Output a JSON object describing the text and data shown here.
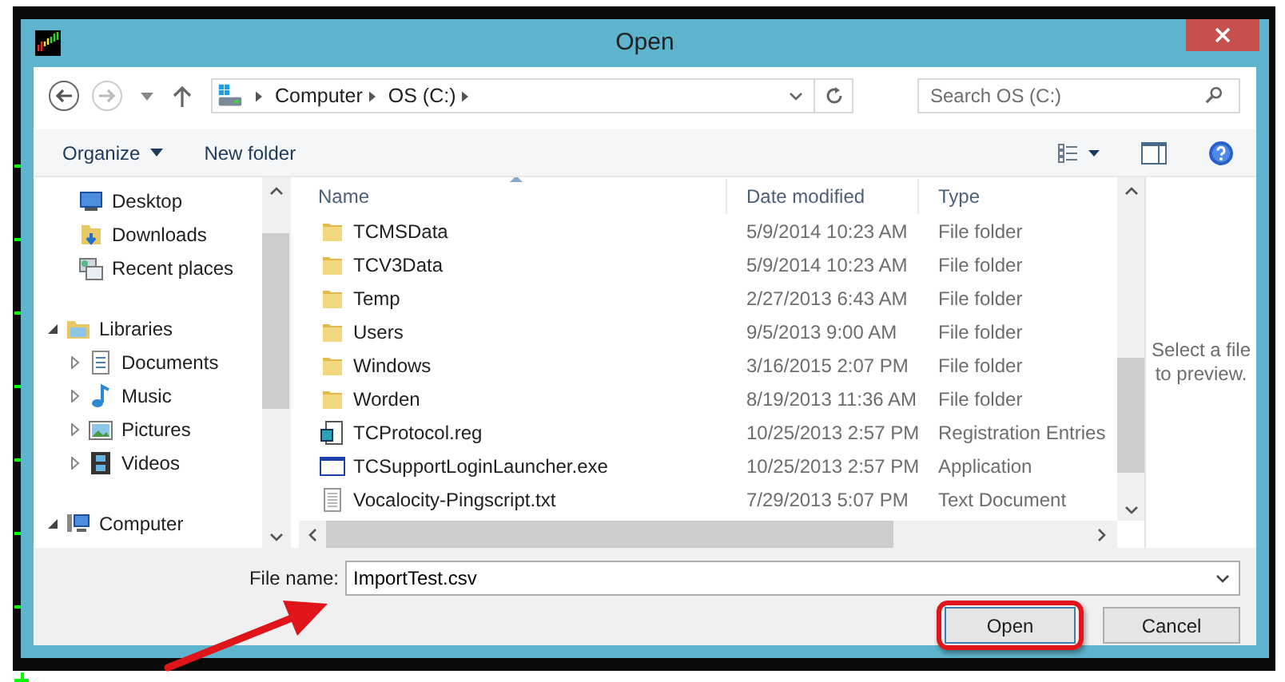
{
  "window": {
    "title": "Open"
  },
  "address": {
    "crumbs": [
      "Computer",
      "OS (C:)"
    ]
  },
  "search": {
    "placeholder": "Search OS (C:)"
  },
  "toolbar": {
    "organize": "Organize",
    "new_folder": "New folder"
  },
  "nav_tree": [
    {
      "label": "Desktop",
      "kind": "desktop"
    },
    {
      "label": "Downloads",
      "kind": "downloads"
    },
    {
      "label": "Recent places",
      "kind": "recent"
    },
    {
      "label": "Libraries",
      "kind": "libraries",
      "expanded": true,
      "children": [
        {
          "label": "Documents",
          "kind": "documents",
          "expanded": false
        },
        {
          "label": "Music",
          "kind": "music",
          "expanded": false
        },
        {
          "label": "Pictures",
          "kind": "pictures",
          "expanded": false
        },
        {
          "label": "Videos",
          "kind": "videos",
          "expanded": false
        }
      ]
    },
    {
      "label": "Computer",
      "kind": "computer",
      "expanded": true
    }
  ],
  "files": {
    "columns": [
      "Name",
      "Date modified",
      "Type"
    ],
    "rows": [
      {
        "name": "TCMSData",
        "date": "5/9/2014 10:23 AM",
        "type": "File folder",
        "kind": "folder"
      },
      {
        "name": "TCV3Data",
        "date": "5/9/2014 10:23 AM",
        "type": "File folder",
        "kind": "folder"
      },
      {
        "name": "Temp",
        "date": "2/27/2013 6:43 AM",
        "type": "File folder",
        "kind": "folder"
      },
      {
        "name": "Users",
        "date": "9/5/2013 9:00 AM",
        "type": "File folder",
        "kind": "folder"
      },
      {
        "name": "Windows",
        "date": "3/16/2015 2:07 PM",
        "type": "File folder",
        "kind": "folder"
      },
      {
        "name": "Worden",
        "date": "8/19/2013 11:36 AM",
        "type": "File folder",
        "kind": "folder"
      },
      {
        "name": "TCProtocol.reg",
        "date": "10/25/2013 2:57 PM",
        "type": "Registration Entries",
        "kind": "reg"
      },
      {
        "name": "TCSupportLoginLauncher.exe",
        "date": "10/25/2013 2:57 PM",
        "type": "Application",
        "kind": "exe"
      },
      {
        "name": "Vocalocity-Pingscript.txt",
        "date": "7/29/2013 5:07 PM",
        "type": "Text Document",
        "kind": "txt"
      }
    ]
  },
  "preview": {
    "message": "Select a file to preview."
  },
  "file_name": {
    "label": "File name:",
    "value": "ImportTest.csv"
  },
  "buttons": [
    {
      "label": "Open",
      "highlighted": true
    },
    {
      "label": "Cancel",
      "highlighted": false
    }
  ]
}
